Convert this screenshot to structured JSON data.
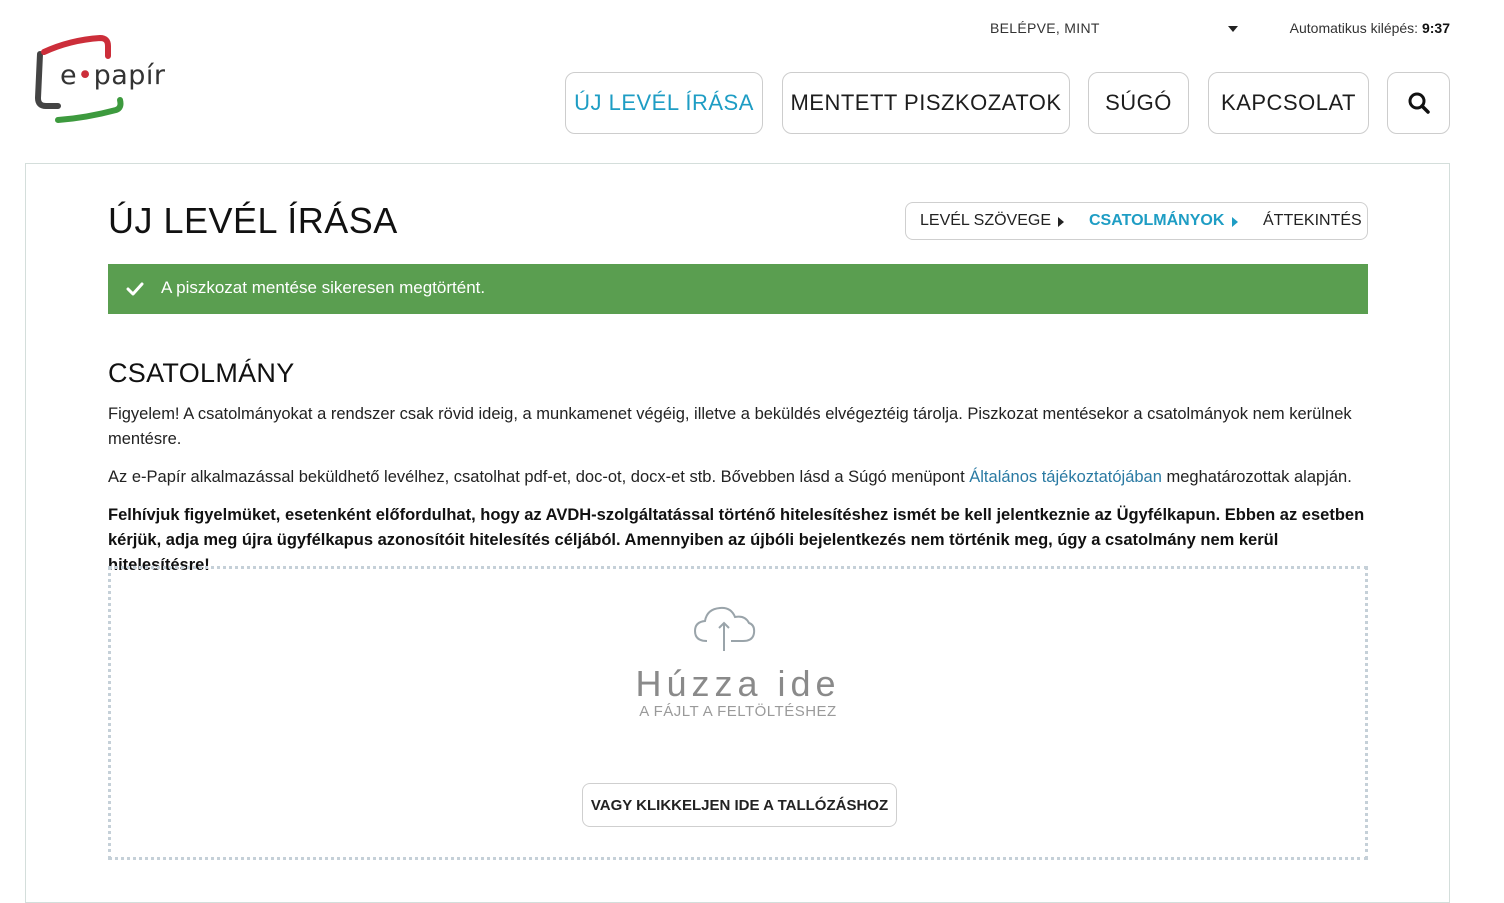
{
  "header": {
    "logged_in_label": "BELÉPVE, MINT",
    "auto_logout_label": "Automatikus kilépés:",
    "auto_logout_time": "9:37"
  },
  "logo": {
    "text_prefix": "e",
    "text_dot": "•",
    "text_suffix": "papír"
  },
  "nav": {
    "items": [
      {
        "label": "ÚJ LEVÉL ÍRÁSA",
        "active": true
      },
      {
        "label": "MENTETT PISZKOZATOK",
        "active": false
      },
      {
        "label": "SÚGÓ",
        "active": false
      },
      {
        "label": "KAPCSOLAT",
        "active": false
      }
    ],
    "search_icon": "search-icon"
  },
  "page": {
    "title": "ÚJ LEVÉL ÍRÁSA",
    "steps": [
      {
        "label": "LEVÉL SZÖVEGE",
        "active": false
      },
      {
        "label": "CSATOLMÁNYOK",
        "active": true
      },
      {
        "label": "ÁTTEKINTÉS",
        "active": false
      }
    ],
    "alert": "A piszkozat mentése sikeresen megtörtént.",
    "section_title": "CSATOLMÁNY",
    "paragraph1": "Figyelem! A csatolmányokat a rendszer csak rövid ideig, a munkamenet végéig, illetve a beküldés elvégeztéig tárolja. Piszkozat mentésekor a csatolmányok nem kerülnek mentésre.",
    "paragraph2_before": "Az e-Papír alkalmazással beküldhető levélhez, csatolhat pdf-et, doc-ot, docx-et stb. Bővebben lásd a Súgó menüpont ",
    "paragraph2_link": "Általános tájékoztatójában",
    "paragraph2_after": " meghatározottak alapján.",
    "paragraph3": "Felhívjuk figyelmüket, esetenként előfordulhat, hogy az AVDH-szolgáltatással történő hitelesítéshez ismét be kell jelentkeznie az Ügyfélkapun. Ebben az esetben kérjük, adja meg újra ügyfélkapus azonosítóit hitelesítés céljából. Amennyiben az újbóli bejelentkezés nem történik meg, úgy a csatolmány nem kerül hitelesítésre!",
    "dropzone": {
      "title": "Húzza ide",
      "subtitle": "A FÁJLT A FELTÖLTÉSHEZ",
      "browse_label": "VAGY KLIKKELJEN IDE A TALLÓZÁSHOZ"
    }
  },
  "colors": {
    "accent": "#1e9dc4",
    "success": "#5a9e50",
    "logo_red": "#cc2e3a",
    "logo_green": "#3d9a3e"
  }
}
